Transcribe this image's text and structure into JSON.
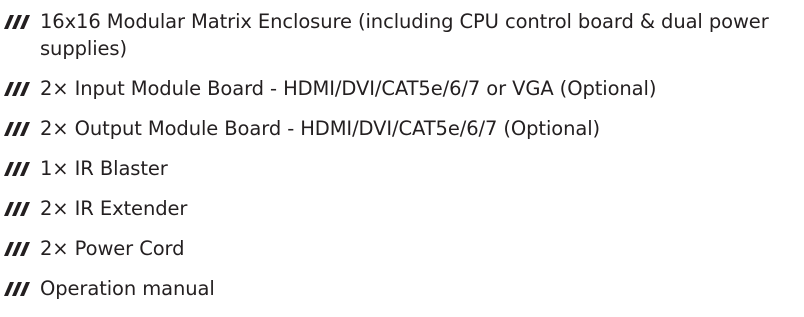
{
  "bullet_icon": "triple-slash-icon",
  "items": [
    "16x16 Modular Matrix Enclosure (including CPU control board & dual power supplies)",
    "2× Input Module Board - HDMI/DVI/CAT5e/6/7 or VGA (Optional)",
    "2× Output Module Board - HDMI/DVI/CAT5e/6/7 (Optional)",
    "1× IR Blaster",
    "2× IR Extender",
    "2× Power Cord",
    "Operation manual"
  ]
}
